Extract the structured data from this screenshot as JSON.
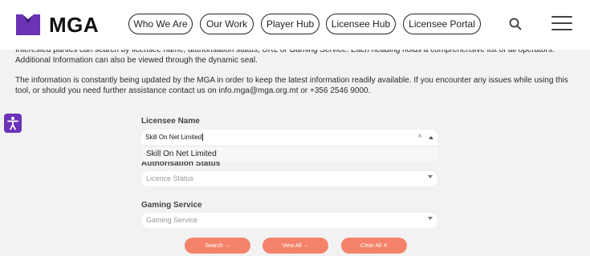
{
  "header": {
    "brand": "MGA",
    "nav": [
      {
        "label": "Who We Are"
      },
      {
        "label": "Our Work"
      },
      {
        "label": "Player Hub"
      },
      {
        "label": "Licensee Hub"
      },
      {
        "label": "Licensee Portal"
      }
    ],
    "colors": {
      "logo_primary": "#6c32b7",
      "logo_dark": "#3d1a78"
    }
  },
  "content": {
    "para1": "Interested parties can search by licensee name, authorisation status, URL or Gaming Service. Each heading holds a comprehensive list of all operators. Additional Information can also be viewed through the dynamic seal.",
    "para2": "The information is constantly being updated by the MGA in order to keep the latest information readily available. If you encounter any issues while using this tool, or should you need further assistance contact us on info.mga@mga.org.mt or +356 2546 9000."
  },
  "form": {
    "licensee_name": {
      "label": "Licensee Name",
      "value": "Skill On Net Limited"
    },
    "suggestion": "Skill On Net Limited",
    "authorisation_status": {
      "label": "Authorisation Status",
      "placeholder": "Licence Status"
    },
    "gaming_service": {
      "label": "Gaming Service",
      "placeholder": "Gaming Service"
    },
    "buttons": {
      "search": "Search →",
      "view_all": "View All →",
      "clear_all": "Clear All ✕"
    },
    "colors": {
      "button": "#f4836a",
      "accessibility": "#6c32b7"
    }
  }
}
